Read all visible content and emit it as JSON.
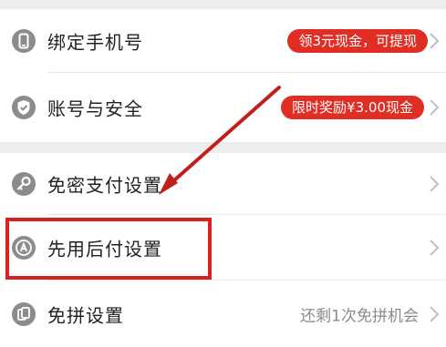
{
  "settings": {
    "bind_phone": {
      "label": "绑定手机号",
      "badge": "领3元现金，可提现",
      "icon": "phone-icon"
    },
    "account_security": {
      "label": "账号与安全",
      "badge": "限时奖励¥3.00现金",
      "icon": "shield-check-icon"
    },
    "password_free_pay": {
      "label": "免密支付设置",
      "icon": "key-icon"
    },
    "pay_later": {
      "label": "先用后付设置",
      "icon": "badge-a-icon"
    },
    "free_group": {
      "label": "免拼设置",
      "hint": "还剩1次免拼机会",
      "icon": "free-group-icon"
    }
  },
  "colors": {
    "accent": "#e02e24",
    "annotation": "#c0201b",
    "icon": "#8c8c8c"
  }
}
